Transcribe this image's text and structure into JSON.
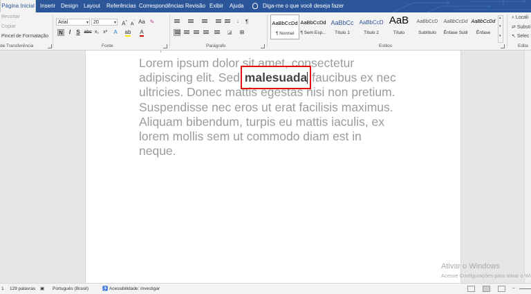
{
  "tabs": [
    {
      "label": "Página Inicial",
      "active": true
    },
    {
      "label": "Inserir"
    },
    {
      "label": "Design"
    },
    {
      "label": "Layout"
    },
    {
      "label": "Referências"
    },
    {
      "label": "Correspondências"
    },
    {
      "label": "Revisão"
    },
    {
      "label": "Exibir"
    },
    {
      "label": "Ajuda"
    }
  ],
  "tell_me": "Diga-me o que você deseja fazer",
  "clipboard": {
    "cut": "Recortar",
    "copy": "Copiar",
    "format_painter": "Pincel de Formatação",
    "group": "de Transferência"
  },
  "font": {
    "name": "Arial",
    "size": "20",
    "group": "Fonte",
    "bold": "N",
    "italic": "I",
    "underline": "S",
    "strike": "abc",
    "subscript": "x₂",
    "superscript": "x²"
  },
  "paragraph": {
    "group": "Parágrafo"
  },
  "styles": {
    "group": "Estilos",
    "items": [
      {
        "preview": "AaBbCcDd",
        "name": "¶ Normal",
        "selected": true
      },
      {
        "preview": "AaBbCcDd",
        "name": "¶ Sem Esp..."
      },
      {
        "preview": "AaBbCc",
        "name": "Título 1"
      },
      {
        "preview": "AaBbCcD",
        "name": "Título 2"
      },
      {
        "preview": "AaB",
        "name": "Título"
      },
      {
        "preview": "AaBbCcD",
        "name": "Subtítulo"
      },
      {
        "preview": "AaBbCcDd",
        "name": "Ênfase Sutil"
      },
      {
        "preview": "AaBbCcDd",
        "name": "Ênfase"
      }
    ]
  },
  "editing": {
    "find": "Locali",
    "replace": "Substi",
    "select": "Selec",
    "group": "Edita"
  },
  "document": {
    "lines": [
      "Lorem ipsum dolor sit amet, consectetur",
      "ultricies. Donec mattis egestas nisi non pretium.",
      "Suspendisse nec eros ut erat facilisis maximus.",
      "Aliquam bibendum, turpis eu mattis iaculis, ex",
      "lorem mollis sem ut commodo diam est in",
      "neque."
    ],
    "line2_before": "adipiscing elit. Sed",
    "highlight": "malesuada",
    "line2_after": "faucibus ex nec"
  },
  "watermark": {
    "title": "Ativar o Windows",
    "subtitle": "Acesse Configurações para ativar o Windows."
  },
  "status": {
    "page": "1",
    "words": "129 palavras",
    "language": "Português (Brasil)",
    "accessibility": "Acessibilidade: investigar"
  }
}
